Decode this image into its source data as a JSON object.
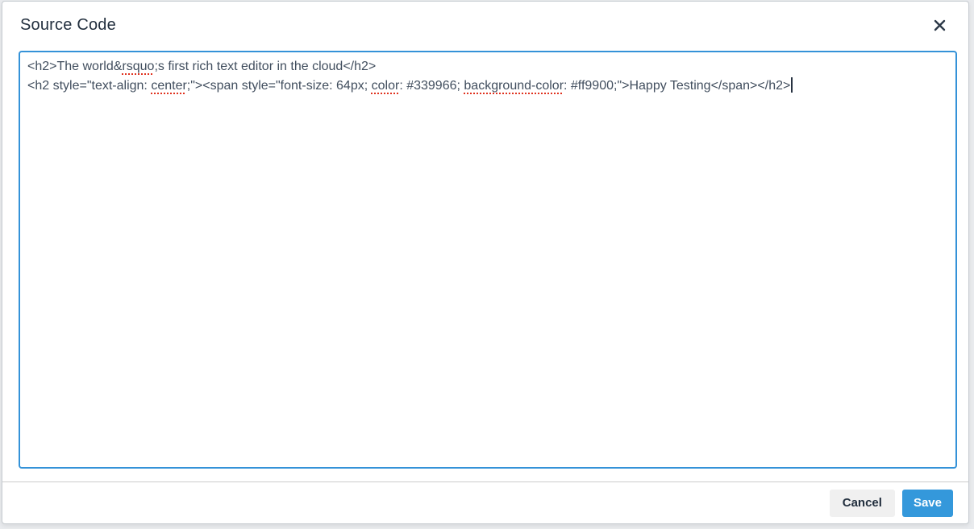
{
  "dialog": {
    "title": "Source Code"
  },
  "icons": {
    "close": "✕"
  },
  "source_editor": {
    "caret_at_end": true,
    "lines": [
      {
        "segments": [
          {
            "text": "<h2>The world&"
          },
          {
            "text": "rsquo",
            "misspelled": true
          },
          {
            "text": ";s first rich text editor in the cloud</h2>"
          }
        ]
      },
      {
        "segments": [
          {
            "text": "<h2 style=\"text-align: "
          },
          {
            "text": "center",
            "misspelled": true
          },
          {
            "text": ";\"><span style=\"font-size: 64px; "
          },
          {
            "text": "color",
            "misspelled": true
          },
          {
            "text": ": #339966; "
          },
          {
            "text": "background-color",
            "misspelled": true
          },
          {
            "text": ": #ff9900;\">Happy Testing</span></h2>"
          }
        ]
      }
    ]
  },
  "footer": {
    "cancel_label": "Cancel",
    "save_label": "Save"
  },
  "colors": {
    "accent_blue": "#3498db",
    "focus_border": "#3492d8",
    "title_text": "#222f3e",
    "code_text": "#414e5e",
    "misspell_red": "#e0321f",
    "text_color_in_code": "#339966",
    "bg_color_in_code": "#ff9900"
  }
}
